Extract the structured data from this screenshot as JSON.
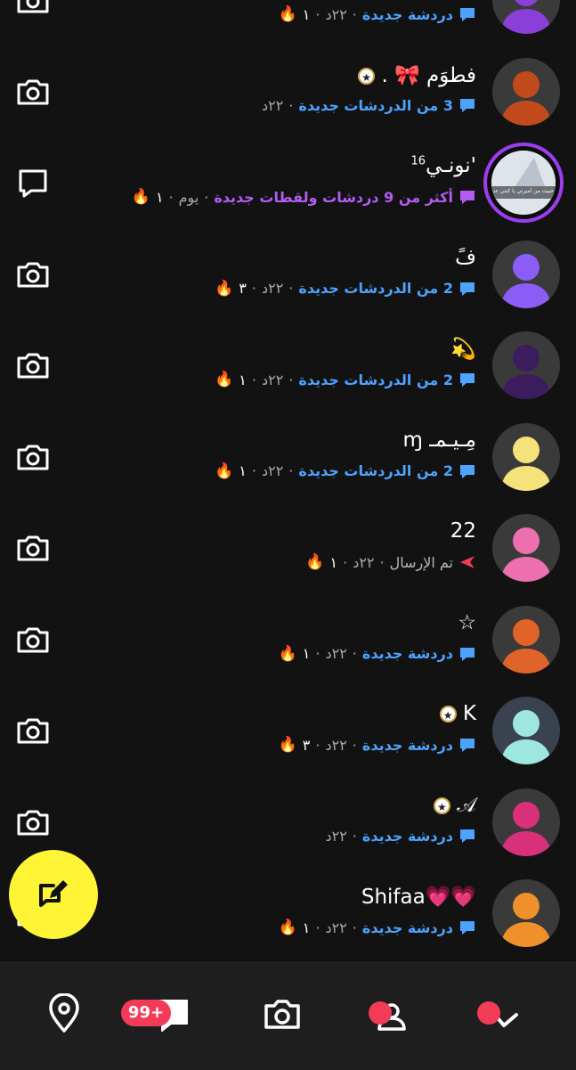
{
  "chats": [
    {
      "name": "",
      "label": "دردشة جديدة",
      "label_style": "blue",
      "time": "٢٢د",
      "streak": "١",
      "fire": true,
      "avatar_color": "#8a3fd8",
      "action": "camera"
    },
    {
      "name": "فطوَم 🎀 .",
      "star": true,
      "label": "3 من الدردشات جديدة",
      "label_style": "blue",
      "time": "٢٢د",
      "streak": "",
      "fire": false,
      "avatar_color": "#c04a1c",
      "action": "camera"
    },
    {
      "name": "'نونـي",
      "sup": "16",
      "label": "أكثر من 9 دردشات ولقطات جديدة",
      "label_style": "purple",
      "time": "يوم",
      "streak": "١",
      "fire": true,
      "story": true,
      "action": "chat"
    },
    {
      "name": "فً",
      "label": "2 من الدردشات جديدة",
      "label_style": "blue",
      "time": "٢٢د",
      "streak": "٣",
      "fire": true,
      "avatar_color": "#8b5cf6",
      "action": "camera"
    },
    {
      "name": "💫",
      "label": "2 من الدردشات جديدة",
      "label_style": "blue",
      "time": "٢٢د",
      "streak": "١",
      "fire": true,
      "avatar_color": "#3b1d5e",
      "action": "camera"
    },
    {
      "name": "مِـيـمـ ɱ",
      "label": "2 من الدردشات جديدة",
      "label_style": "blue",
      "time": "٢٢د",
      "streak": "١",
      "fire": true,
      "avatar_color": "#f5e27a",
      "action": "camera"
    },
    {
      "name": "22",
      "label": "تم الإرسال",
      "label_style": "gray",
      "sent": true,
      "time": "٢٢د",
      "streak": "١",
      "fire": true,
      "avatar_color": "#ee6fb0",
      "action": "camera"
    },
    {
      "name": "☆",
      "label": "دردشة جديدة",
      "label_style": "blue",
      "time": "٢٢د",
      "streak": "١",
      "fire": true,
      "avatar_color": "#e0632a",
      "action": "camera"
    },
    {
      "name": "K",
      "star": true,
      "label": "دردشة جديدة",
      "label_style": "blue",
      "time": "٢٢د",
      "streak": "٣",
      "fire": true,
      "avatar_color": "#9ee6e0",
      "avatar_bg": "#3a4250",
      "action": "camera"
    },
    {
      "name": "𝒜",
      "star": true,
      "label": "دردشة جديدة",
      "label_style": "blue",
      "time": "٢٢د",
      "streak": "",
      "fire": false,
      "avatar_color": "#d9307c",
      "action": "camera"
    },
    {
      "name": "💗💗Shifaa",
      "label": "دردشة جديدة",
      "label_style": "blue",
      "time": "٢٢د",
      "streak": "١",
      "fire": true,
      "avatar_color": "#f0902a",
      "action": "camera"
    }
  ],
  "separator": "·",
  "story_thumb_text": "حبيت من أميرتي يا كنتي عندكم",
  "nav": {
    "badge": "99+",
    "items": [
      "map-pin-icon",
      "chat-icon",
      "camera-icon",
      "friends-icon",
      "spotlight-icon"
    ]
  },
  "colors": {
    "accent_blue": "#4da3ff",
    "purple": "#b35cf4",
    "fab_yellow": "#fff436",
    "badge_red": "#f23c57"
  }
}
